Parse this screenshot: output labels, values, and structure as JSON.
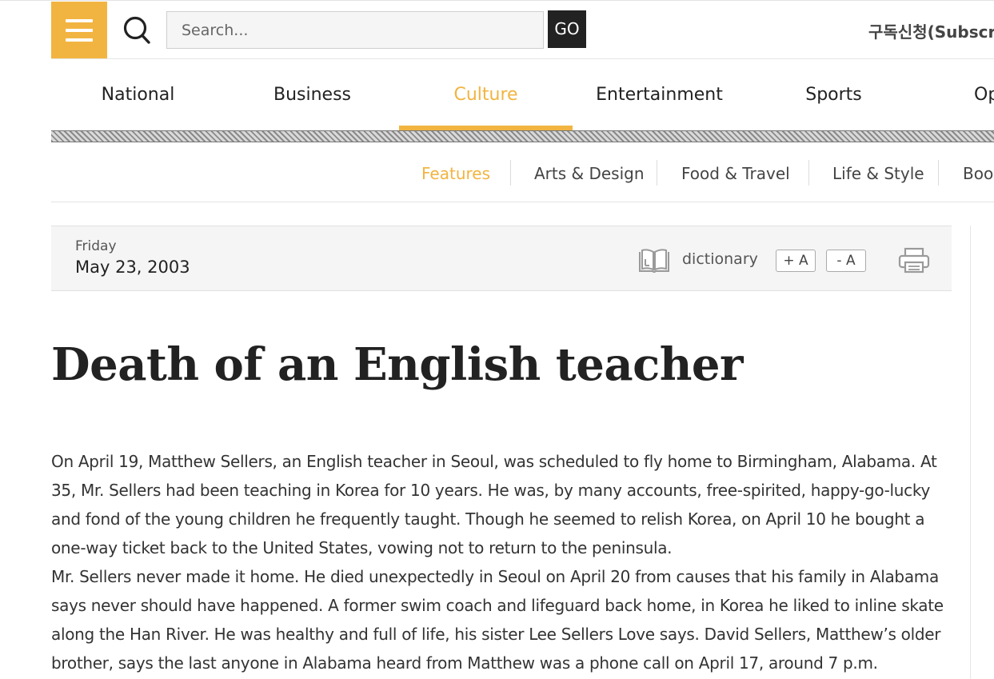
{
  "header": {
    "search_placeholder": "Search...",
    "go_label": "GO",
    "subscribe_label": "구독신청(Subscri"
  },
  "nav": {
    "items": [
      "National",
      "Business",
      "Culture",
      "Entertainment",
      "Sports",
      "Op"
    ],
    "active": "Culture"
  },
  "subnav": {
    "items": [
      "Features",
      "Arts & Design",
      "Food & Travel",
      "Life & Style",
      "Boo"
    ],
    "active": "Features"
  },
  "infobar": {
    "day": "Friday",
    "date": "May 23, 2003",
    "dictionary_label": "dictionary",
    "font_increase_label": "+ A",
    "font_decrease_label": "- A"
  },
  "article": {
    "title": "Death of an English teacher",
    "paragraphs": [
      "On April 19, Matthew Sellers, an English teacher in Seoul, was scheduled to fly home to Birmingham, Alabama. At 35, Mr. Sellers had been teaching in Korea for 10 years. He was, by many accounts, free-spirited, happy-go-lucky and fond of the young children he frequently taught. Though he seemed to relish Korea, on April 10 he bought a one-way ticket back to the United States, vowing not to return to the peninsula.",
      "Mr. Sellers never made it home. He died unexpectedly in Seoul on April 20 from causes that his family in Alabama says never should have happened. A former swim coach and lifeguard back home, in Korea he liked to inline skate along the Han River. He was healthy and full of life, his sister Lee Sellers Love says. David Sellers, Matthew’s older brother, says the last anyone in Alabama heard from Matthew was a phone call on April 17, around 7 p.m."
    ]
  },
  "colors": {
    "accent": "#f2b441",
    "go_button": "#222222",
    "infobar_bg": "#f5f5f5"
  },
  "icons": {
    "menu": "hamburger-icon",
    "search": "search-icon",
    "dictionary": "book-icon",
    "print": "printer-icon"
  }
}
